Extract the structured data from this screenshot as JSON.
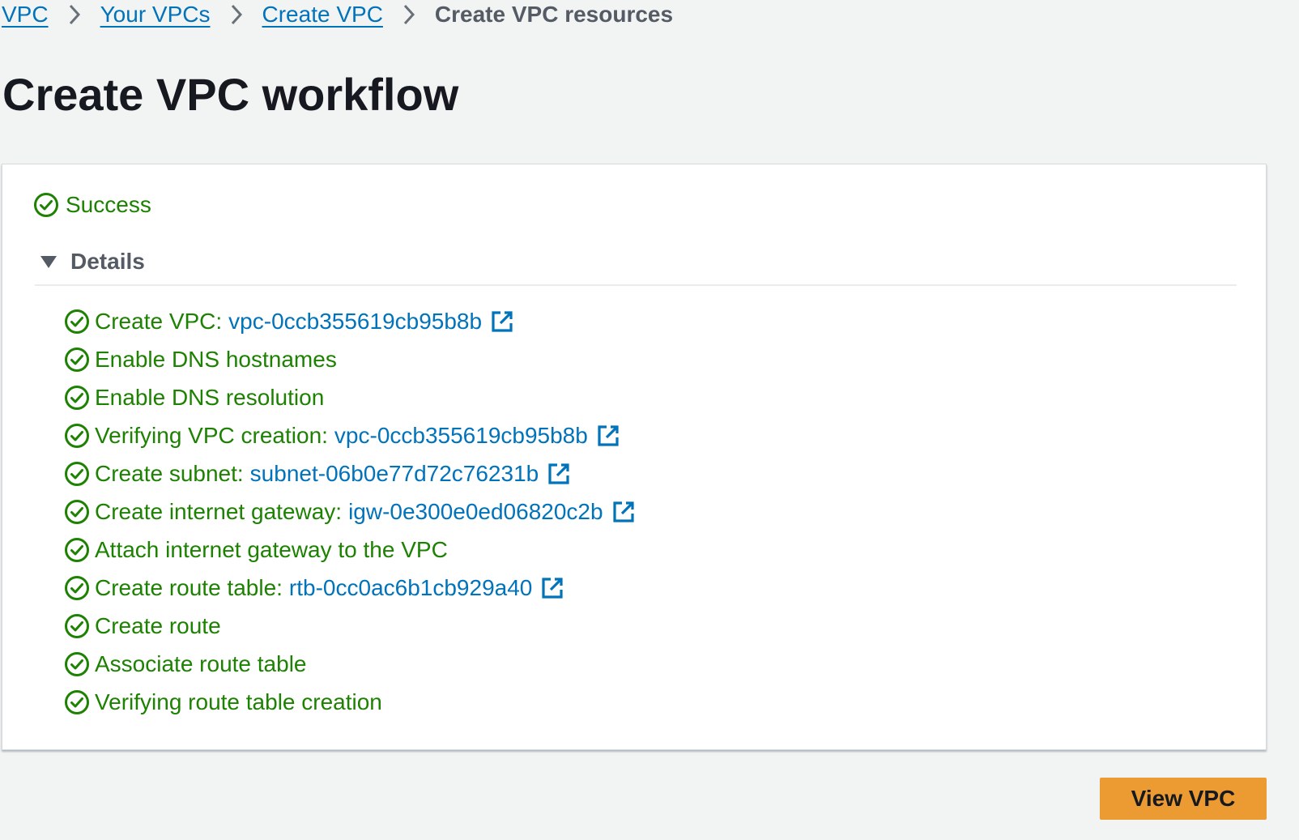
{
  "breadcrumb": {
    "items": [
      {
        "label": "VPC"
      },
      {
        "label": "Your VPCs"
      },
      {
        "label": "Create VPC"
      }
    ],
    "current": "Create VPC resources"
  },
  "page": {
    "title": "Create VPC workflow"
  },
  "result": {
    "status": "Success",
    "status_color": "#1d8102",
    "details_label": "Details",
    "details_expanded": true,
    "steps": [
      {
        "label": "Create VPC:",
        "link": "vpc-0ccb355619cb95b8b"
      },
      {
        "label": "Enable DNS hostnames"
      },
      {
        "label": "Enable DNS resolution"
      },
      {
        "label": "Verifying VPC creation:",
        "link": "vpc-0ccb355619cb95b8b"
      },
      {
        "label": "Create subnet:",
        "link": "subnet-06b0e77d72c76231b"
      },
      {
        "label": "Create internet gateway:",
        "link": "igw-0e300e0ed06820c2b"
      },
      {
        "label": "Attach internet gateway to the VPC"
      },
      {
        "label": "Create route table:",
        "link": "rtb-0cc0ac6b1cb929a40"
      },
      {
        "label": "Create route"
      },
      {
        "label": "Associate route table"
      },
      {
        "label": "Verifying route table creation"
      }
    ]
  },
  "actions": {
    "view_vpc_label": "View VPC",
    "primary_color": "#ec9a32"
  },
  "colors": {
    "link": "#0073bb",
    "success": "#1d8102",
    "background": "#f2f3f3"
  },
  "icons": {
    "breadcrumb_separator": "chevron-right-icon",
    "status": "check-circle-icon",
    "details_toggle": "caret-down-icon",
    "external_link": "external-link-icon"
  }
}
